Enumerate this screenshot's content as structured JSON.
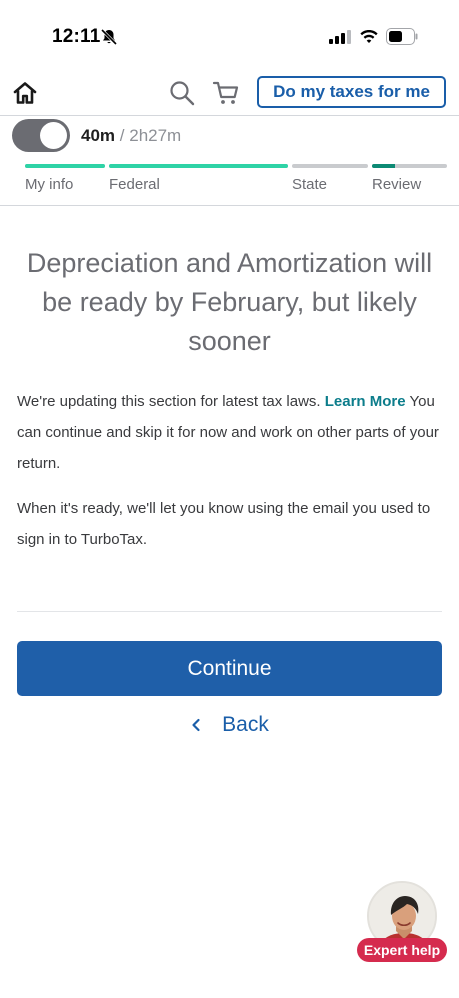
{
  "status_bar": {
    "time": "12:11",
    "icons": [
      "bell-off-icon",
      "signal-icon",
      "wifi-icon",
      "battery-icon"
    ]
  },
  "header": {
    "icons": [
      "home-icon",
      "search-icon",
      "cart-icon"
    ],
    "do_my_taxes_label": "Do my taxes for me"
  },
  "timer": {
    "toggle_on": true,
    "elapsed": "40m",
    "separator": "/",
    "total": "2h27m"
  },
  "progress": {
    "steps": [
      {
        "label": "My info",
        "fill": 1.0
      },
      {
        "label": "Federal",
        "fill": 1.0
      },
      {
        "label": "State",
        "fill": 0.0
      },
      {
        "label": "Review",
        "fill": 0.3
      }
    ],
    "fill_colors": {
      "complete": "#2ed3a6",
      "review": "#0c8a74",
      "empty": "#c9cbce"
    }
  },
  "main": {
    "headline": "Depreciation and Amortization will be ready by February, but likely sooner",
    "paragraph1_text": "We're updating this section for latest tax laws. ",
    "learn_more": "Learn More",
    "paragraph1_rest": " You can continue and skip it for now and work on other parts of your return.",
    "paragraph2": "When it's ready, we'll let you know using the email you used to sign in to TurboTax."
  },
  "actions": {
    "continue_label": "Continue",
    "back_label": "Back"
  },
  "expert_help": {
    "label": "Expert help"
  },
  "colors": {
    "primary_blue": "#1f5fa9",
    "link_teal": "#0c7d8b",
    "expert_red": "#d52b4e"
  }
}
